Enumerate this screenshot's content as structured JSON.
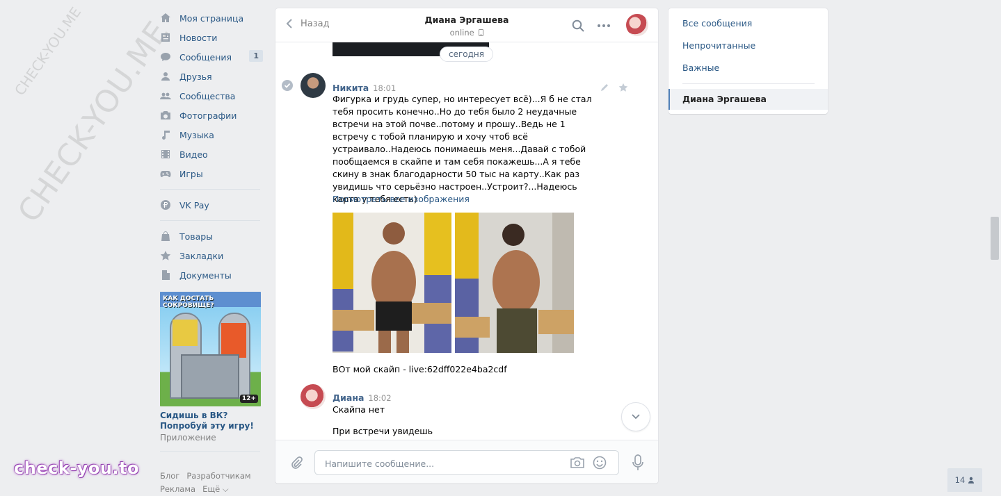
{
  "watermark": {
    "small": "CHECK-YOU.ME",
    "big": "CHECK-YOU.ME",
    "badge": "check-you.to"
  },
  "left_nav": {
    "items": [
      {
        "label": "Моя страница",
        "icon": "home-icon"
      },
      {
        "label": "Новости",
        "icon": "news-icon"
      },
      {
        "label": "Сообщения",
        "icon": "messages-icon",
        "badge": "1"
      },
      {
        "label": "Друзья",
        "icon": "friends-icon"
      },
      {
        "label": "Сообщества",
        "icon": "groups-icon"
      },
      {
        "label": "Фотографии",
        "icon": "camera-icon"
      },
      {
        "label": "Музыка",
        "icon": "music-icon"
      },
      {
        "label": "Видео",
        "icon": "video-icon"
      },
      {
        "label": "Игры",
        "icon": "gamepad-icon"
      }
    ],
    "pay": {
      "label": "VK Pay",
      "icon": "ruble-icon"
    },
    "extra": [
      {
        "label": "Товары",
        "icon": "bag-icon"
      },
      {
        "label": "Закладки",
        "icon": "star-icon"
      },
      {
        "label": "Документы",
        "icon": "document-icon"
      }
    ],
    "ad": {
      "banner_text": "КАК ДОСТАТЬ СОКРОВИЩЕ?",
      "age": "12+",
      "title": "Сидишь в ВК? Попробуй эту игру!",
      "subtitle": "Приложение"
    },
    "footer": {
      "blog": "Блог",
      "developers": "Разработчикам",
      "ads": "Реклама",
      "more": "Ещё ⌵"
    }
  },
  "chat": {
    "back_label": "Назад",
    "peer_name": "Диана Эргашева",
    "peer_status": "online",
    "date_divider": "сегодня",
    "messages": [
      {
        "author": "Никита",
        "time": "18:01",
        "text": "Фигурка и грудь супер, но интересует всё)...Я б не стал тебя просить конечно..Но до тебя было 2 неудачные встречи на этой почве..потому и прошу..Ведь не 1 встречу с тобой планирую и хочу чтоб всё устраивало..Надеюсь понимаешь меня...Давай с тобой пообщаемся в скайпе и там себя покажешь...А я тебе скину в знак благодарности 50 тыс на карту..Как раз увидишь что серьёзно настроен..Устроит?...Надеюсь карта у тебя есть)",
        "link": "Посмотреть все изображения",
        "text2": "ВОт мой скайп - live:62dff022e4ba2cdf"
      },
      {
        "author": "Диана",
        "time": "18:02",
        "text": "Скайпа нет",
        "text2": "При встречи увидешь"
      }
    ],
    "composer_placeholder": "Напишите сообщение..."
  },
  "right_panel": {
    "all": "Все сообщения",
    "unread": "Непрочитанные",
    "important": "Важные",
    "active_chat": "Диана Эргашева"
  },
  "online_counter": "14",
  "colors": {
    "link": "#2a5885",
    "author": "#42648b",
    "background": "#edeef0",
    "accent": "#5181b8"
  }
}
